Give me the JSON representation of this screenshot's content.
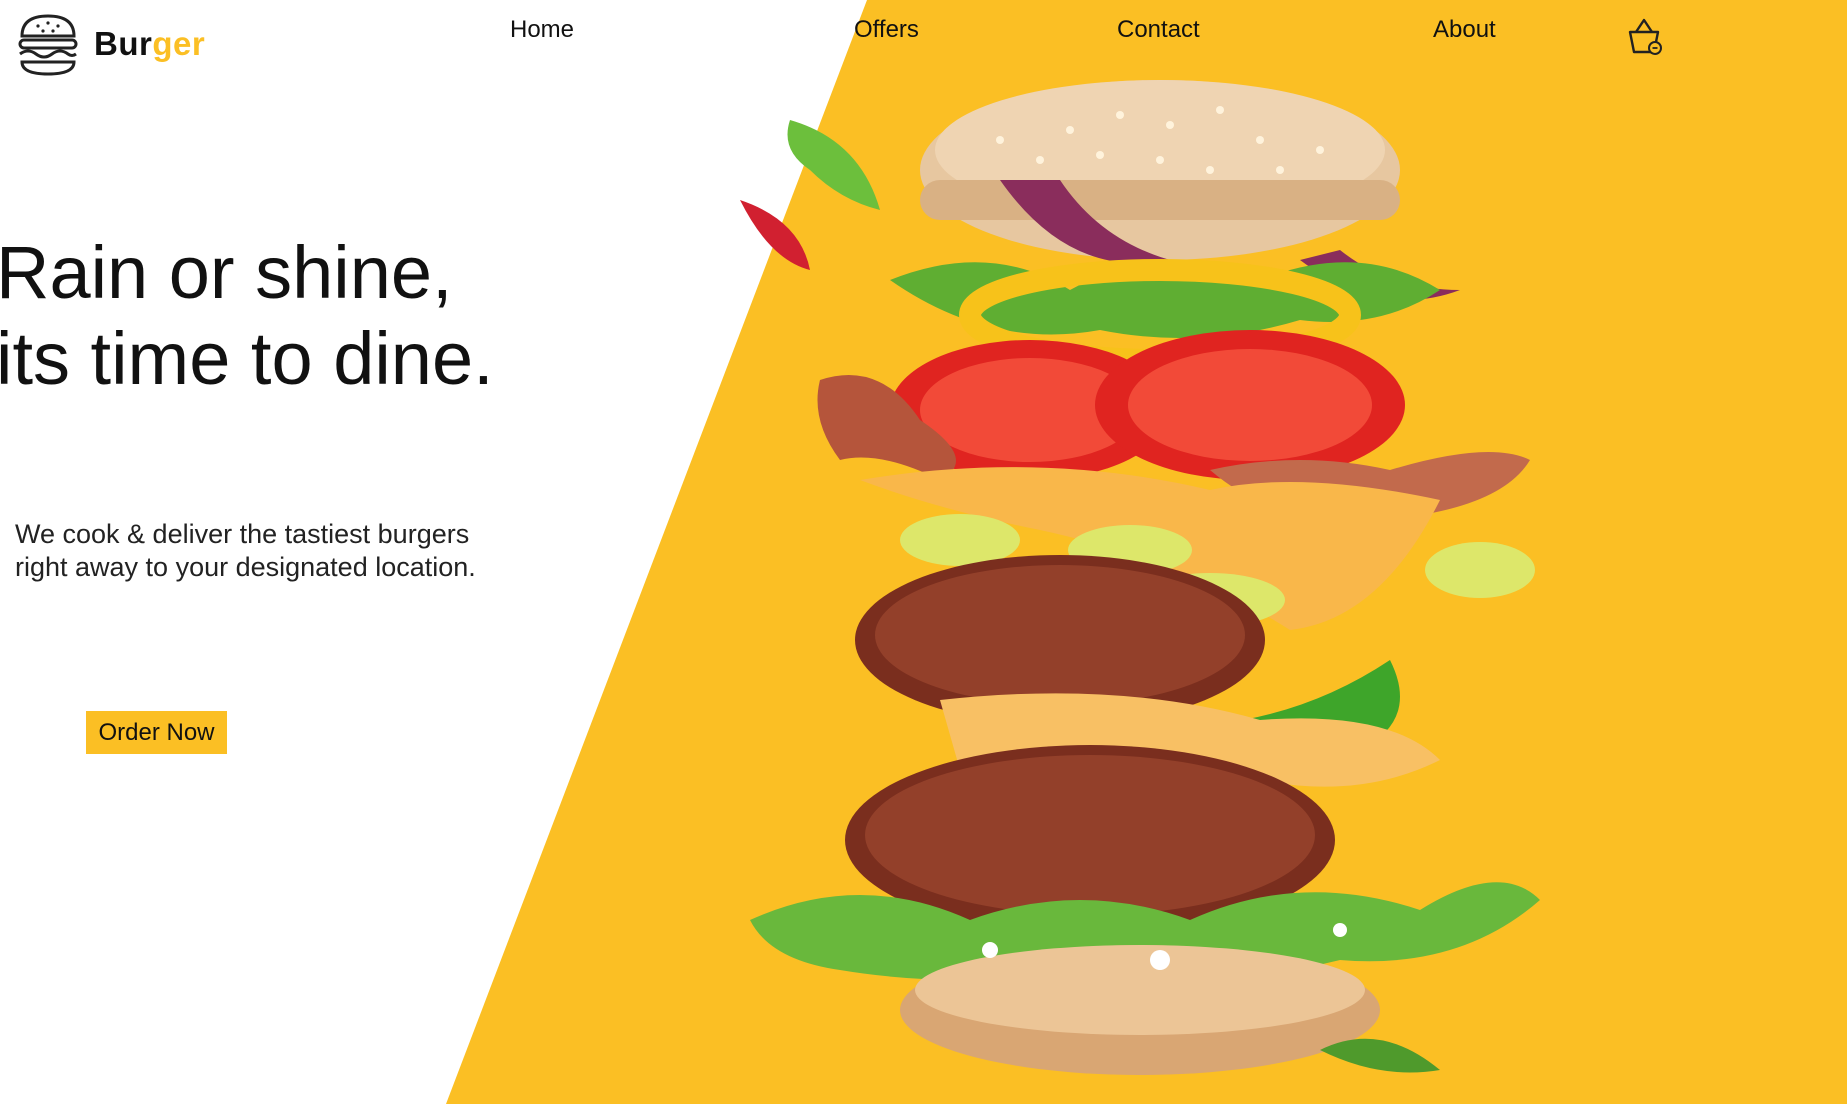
{
  "brand": {
    "name_part1": "Bur",
    "name_part2": "ger",
    "accent_color": "#fbbf24",
    "text_color": "#111111",
    "logo_icon": "burger-outline-icon"
  },
  "nav": {
    "items": [
      {
        "label": "Home"
      },
      {
        "label": "Offers"
      },
      {
        "label": "Contact"
      },
      {
        "label": "About"
      }
    ],
    "cart_icon": "shopping-basket-icon"
  },
  "hero": {
    "title_line1": "Rain or shine,",
    "title_line2": "its time to dine.",
    "subtitle_line1": "We cook & deliver the tastiest burgers",
    "subtitle_line2": "right away to your designated location.",
    "cta_label": "Order Now",
    "background_accent": "#fbbf24"
  }
}
